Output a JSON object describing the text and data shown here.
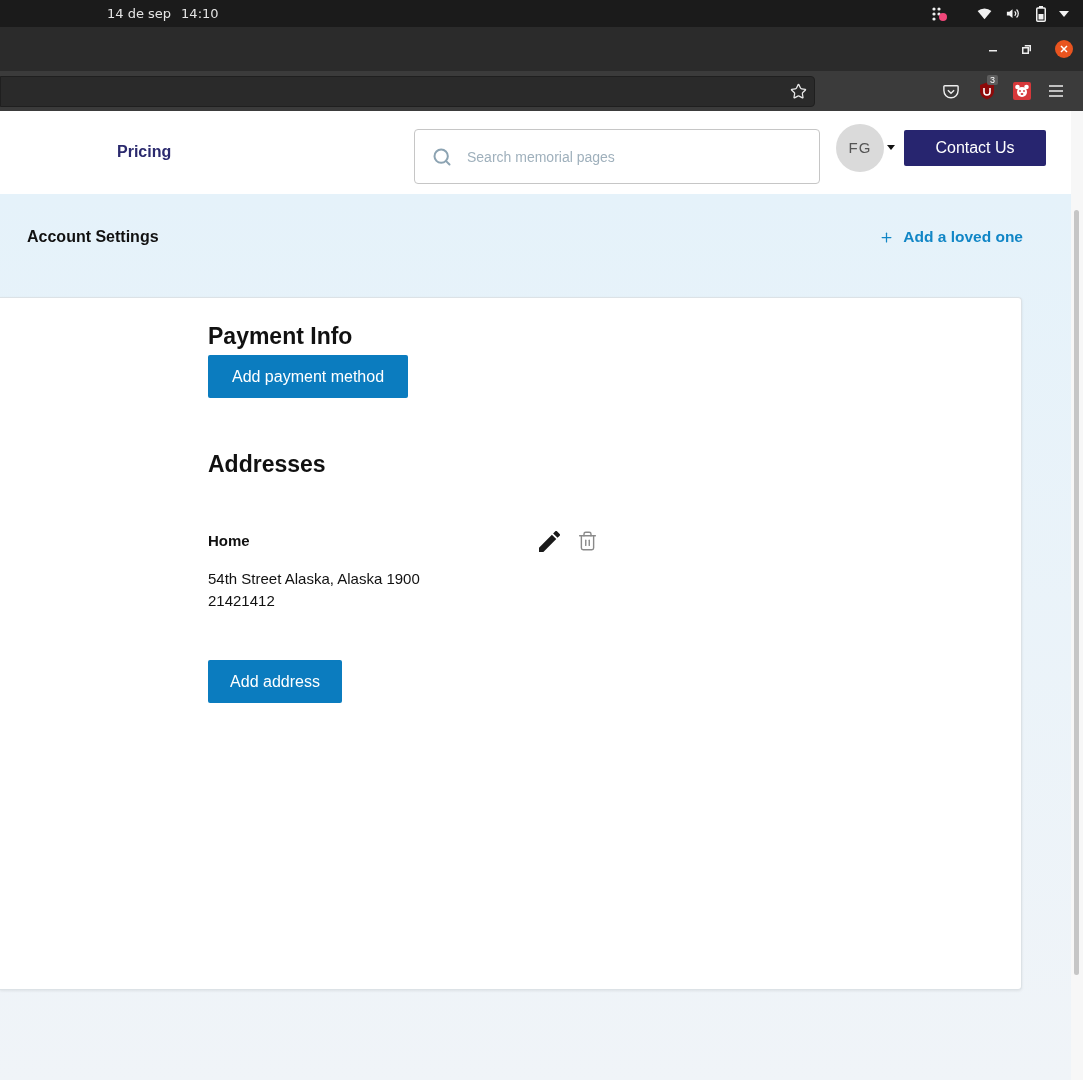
{
  "system_bar": {
    "date": "14 de sep",
    "time": "14:10"
  },
  "browser": {
    "extension_badge": "3"
  },
  "header": {
    "nav": [
      {
        "label": "Pricing"
      }
    ],
    "search": {
      "placeholder": "Search memorial pages"
    },
    "avatar": {
      "initials": "FG"
    },
    "contact_button": "Contact Us"
  },
  "banner": {
    "title": "Account Settings",
    "action": "Add a loved one"
  },
  "payment": {
    "heading": "Payment Info",
    "button": "Add payment method"
  },
  "addresses": {
    "heading": "Addresses",
    "items": [
      {
        "label": "Home",
        "lines": [
          "54th Street Alaska, Alaska 1900",
          "21421412"
        ]
      }
    ],
    "button": "Add address"
  }
}
